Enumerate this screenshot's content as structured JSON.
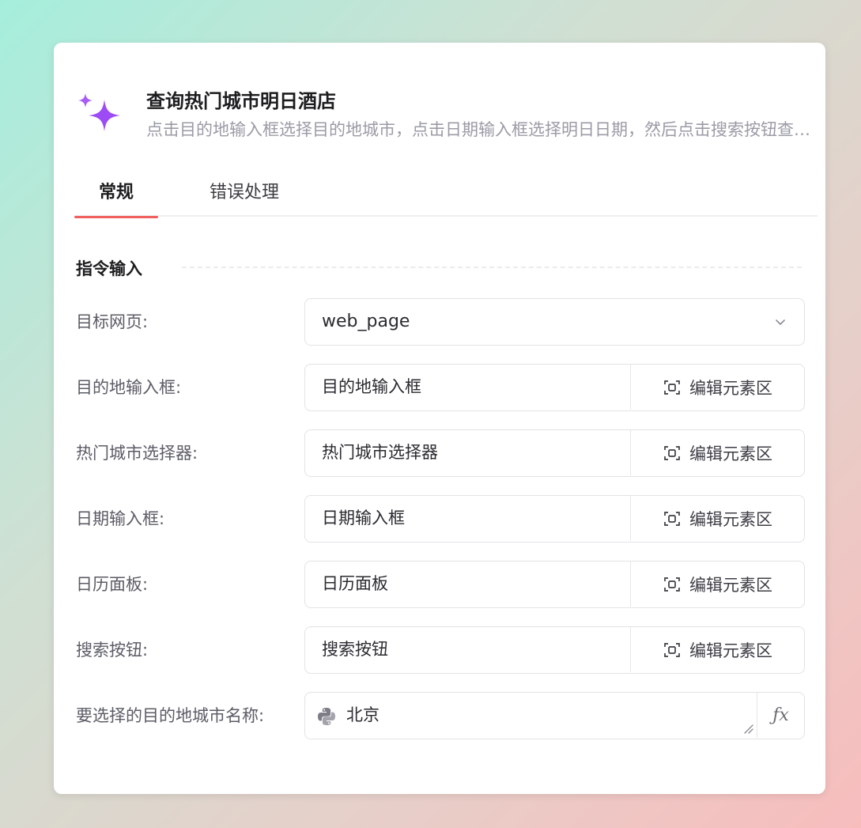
{
  "header": {
    "icon": "sparkle-icon",
    "accent_color": "#9d4cf5",
    "title": "查询热门城市明日酒店",
    "description": "点击目的地输入框选择目的地城市，点击日期输入框选择明日日期，然后点击搜索按钮查询酒店"
  },
  "tabs": [
    {
      "label": "常规",
      "active": true
    },
    {
      "label": "错误处理",
      "active": false
    }
  ],
  "tab_accent_color": "#f0605e",
  "section": {
    "title": "指令输入"
  },
  "fields": [
    {
      "label": "目标网页:",
      "value": "web_page",
      "type": "select"
    },
    {
      "label": "目的地输入框:",
      "value": "目的地输入框",
      "type": "element",
      "action": "编辑元素区"
    },
    {
      "label": "热门城市选择器:",
      "value": "热门城市选择器",
      "type": "element",
      "action": "编辑元素区"
    },
    {
      "label": "日期输入框:",
      "value": "日期输入框",
      "type": "element",
      "action": "编辑元素区"
    },
    {
      "label": "日历面板:",
      "value": "日历面板",
      "type": "element",
      "action": "编辑元素区"
    },
    {
      "label": "搜索按钮:",
      "value": "搜索按钮",
      "type": "element",
      "action": "编辑元素区"
    },
    {
      "label": "要选择的目的地城市名称:",
      "value": "北京",
      "type": "expression",
      "icon": "python-icon",
      "action_icon": "fx-icon"
    }
  ]
}
